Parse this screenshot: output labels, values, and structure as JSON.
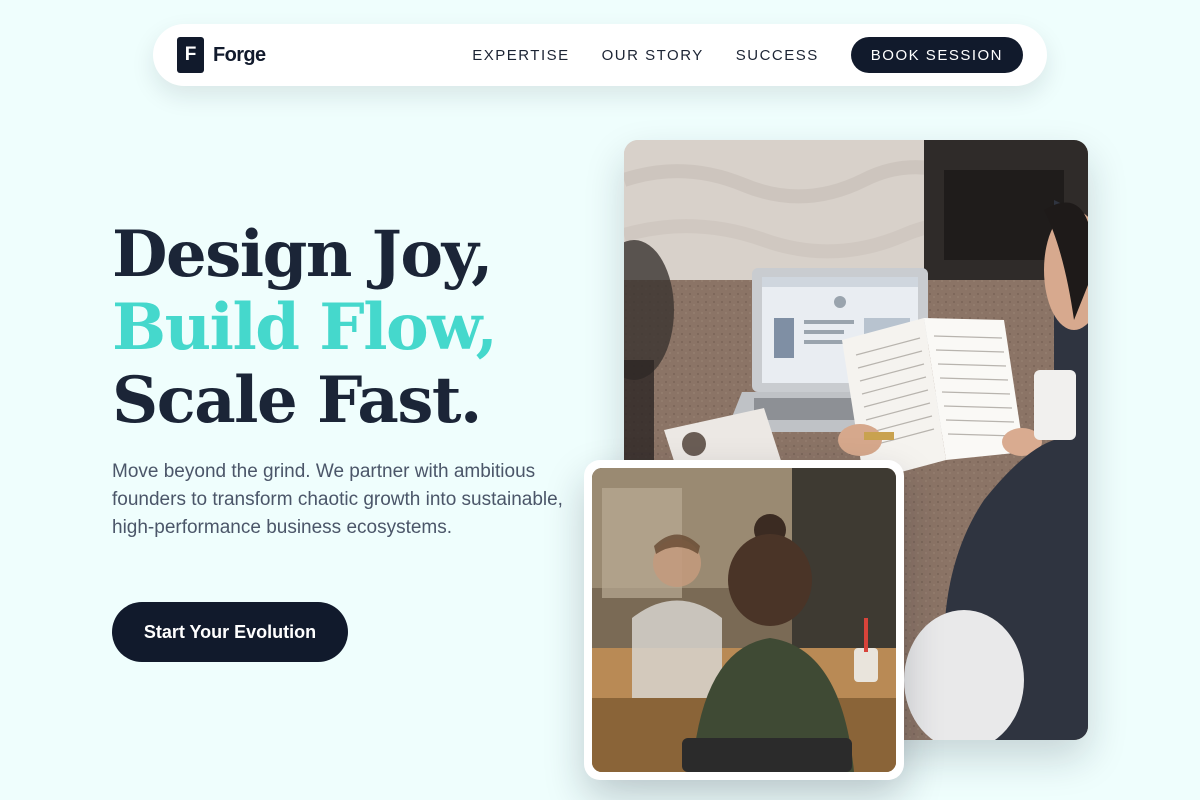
{
  "brand": {
    "mark": "F",
    "name": "Forge"
  },
  "nav": {
    "links": [
      "EXPERTISE",
      "OUR STORY",
      "SUCCESS"
    ],
    "cta": "BOOK SESSION"
  },
  "hero": {
    "headline_line1": "Design Joy,",
    "headline_line2": "Build Flow,",
    "headline_line3": "Scale Fast.",
    "lead": "Move beyond the grind. We partner with ambitious founders to transform chaotic growth into sustainable, high-performance business ecosystems.",
    "cta": "Start Your Evolution"
  },
  "images": {
    "main": "two people reviewing a printed document beside an open laptop on a table",
    "inset": "two people in conversation at a café table"
  },
  "colors": {
    "background": "#effefd",
    "navy": "#111a2c",
    "accent": "#45d8cc",
    "body_text": "#4b5669"
  }
}
